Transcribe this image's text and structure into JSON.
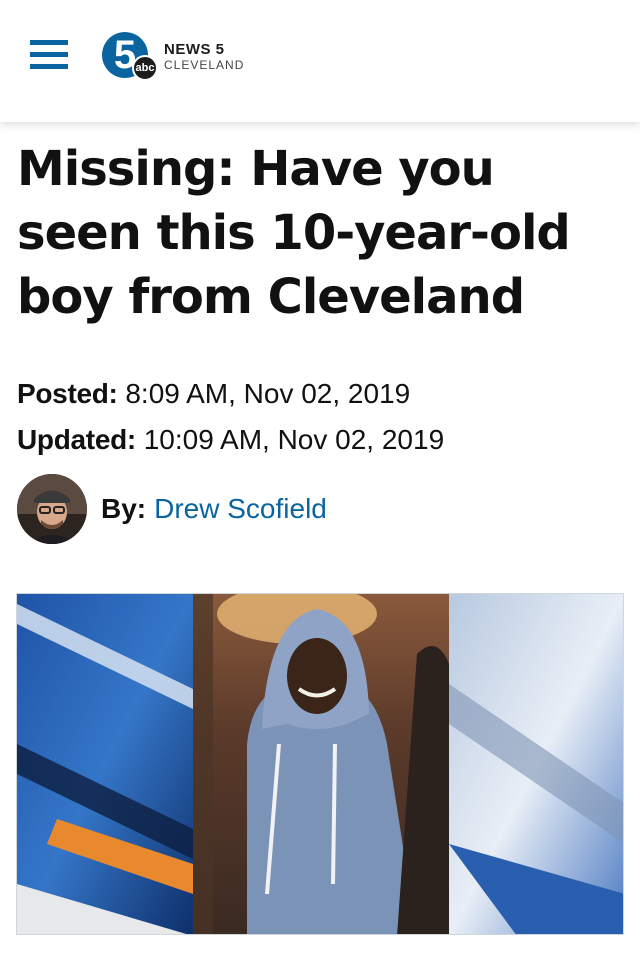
{
  "header": {
    "menu_icon": "hamburger-menu-icon",
    "logo": {
      "badge_number": "5",
      "badge_network": "abc",
      "line1": "NEWS 5",
      "line2": "CLEVELAND"
    }
  },
  "article": {
    "headline": "Missing: Have you seen this 10-year-old boy from Cleveland",
    "posted_label": "Posted:",
    "posted_value": "8:09 AM, Nov 02, 2019",
    "updated_label": "Updated:",
    "updated_value": "10:09 AM, Nov 02, 2019",
    "byline_label": "By:",
    "author": "Drew Scofield"
  },
  "colors": {
    "brand_blue": "#0a64a0",
    "text": "#111111"
  }
}
